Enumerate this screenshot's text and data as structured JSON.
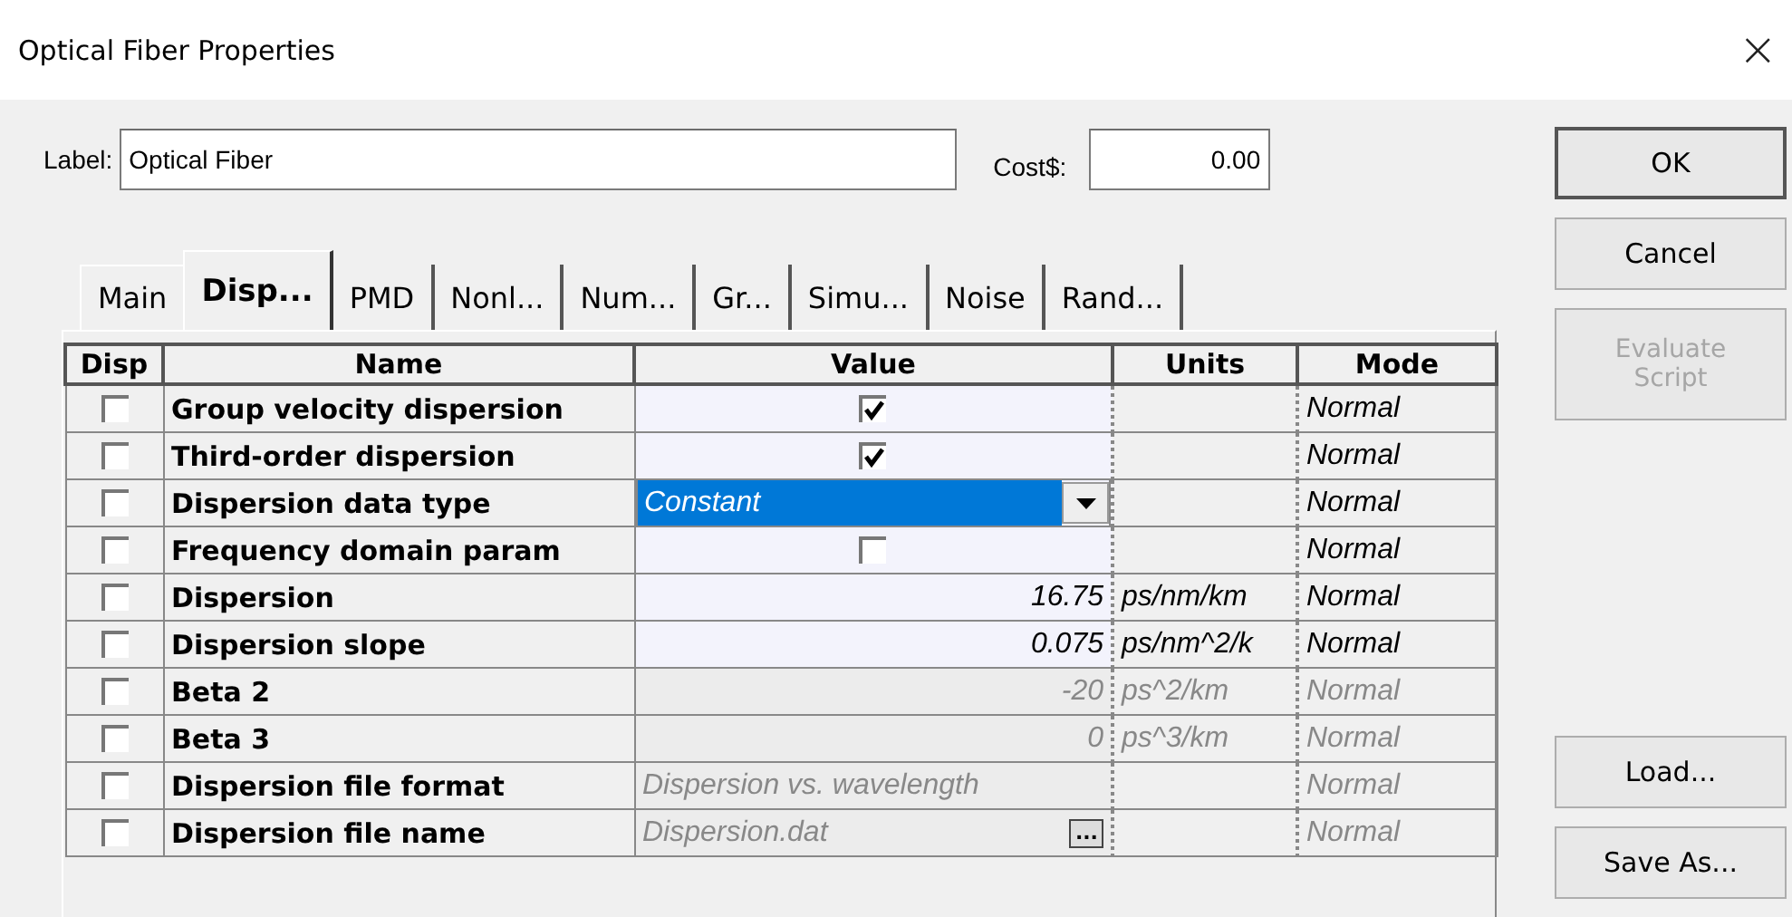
{
  "window": {
    "title": "Optical Fiber Properties",
    "close": "×"
  },
  "label_field": {
    "label": "Label:",
    "value": "Optical Fiber"
  },
  "cost_field": {
    "label": "Cost$:",
    "value": "0.00"
  },
  "tabs": [
    {
      "label": "Main",
      "selected": false
    },
    {
      "label": "Disp...",
      "selected": true
    },
    {
      "label": "PMD",
      "selected": false
    },
    {
      "label": "Nonl...",
      "selected": false
    },
    {
      "label": "Num...",
      "selected": false
    },
    {
      "label": "Gr...",
      "selected": false
    },
    {
      "label": "Simu...",
      "selected": false
    },
    {
      "label": "Noise",
      "selected": false
    },
    {
      "label": "Rand...",
      "selected": false
    }
  ],
  "table": {
    "columns": [
      "Disp",
      "Name",
      "Value",
      "Units",
      "Mode"
    ],
    "rows": [
      {
        "disp": false,
        "name": "Group velocity dispersion",
        "kind": "checkbox",
        "checked": true,
        "mode": "Normal",
        "disabled": false
      },
      {
        "disp": false,
        "name": "Third-order dispersion",
        "kind": "checkbox",
        "checked": true,
        "mode": "Normal",
        "disabled": false
      },
      {
        "disp": false,
        "name": "Dispersion data type",
        "kind": "dropdown",
        "value": "Constant",
        "mode": "Normal",
        "disabled": false
      },
      {
        "disp": false,
        "name": "Frequency domain param",
        "kind": "checkbox",
        "checked": false,
        "mode": "Normal",
        "disabled": false
      },
      {
        "disp": false,
        "name": "Dispersion",
        "kind": "number",
        "value": "16.75",
        "units": "ps/nm/km",
        "mode": "Normal",
        "disabled": false
      },
      {
        "disp": false,
        "name": "Dispersion slope",
        "kind": "number",
        "value": "0.075",
        "units": "ps/nm^2/k",
        "mode": "Normal",
        "disabled": false
      },
      {
        "disp": false,
        "name": "Beta 2",
        "kind": "number",
        "value": "-20",
        "units": "ps^2/km",
        "mode": "Normal",
        "disabled": true
      },
      {
        "disp": false,
        "name": "Beta 3",
        "kind": "number",
        "value": "0",
        "units": "ps^3/km",
        "mode": "Normal",
        "disabled": true
      },
      {
        "disp": false,
        "name": "Dispersion file format",
        "kind": "text",
        "value": "Dispersion vs. wavelength",
        "mode": "Normal",
        "disabled": true
      },
      {
        "disp": false,
        "name": "Dispersion file name",
        "kind": "file",
        "value": "Dispersion.dat",
        "button": "...",
        "mode": "Normal",
        "disabled": true
      }
    ]
  },
  "buttons": [
    {
      "label": "OK",
      "disabled": false,
      "default": true
    },
    {
      "label": "Cancel",
      "disabled": false,
      "default": false
    },
    {
      "label": "Evaluate Script",
      "disabled": true,
      "default": false
    }
  ],
  "bottom_buttons": [
    {
      "label": "Load..."
    },
    {
      "label": "Save As..."
    }
  ]
}
